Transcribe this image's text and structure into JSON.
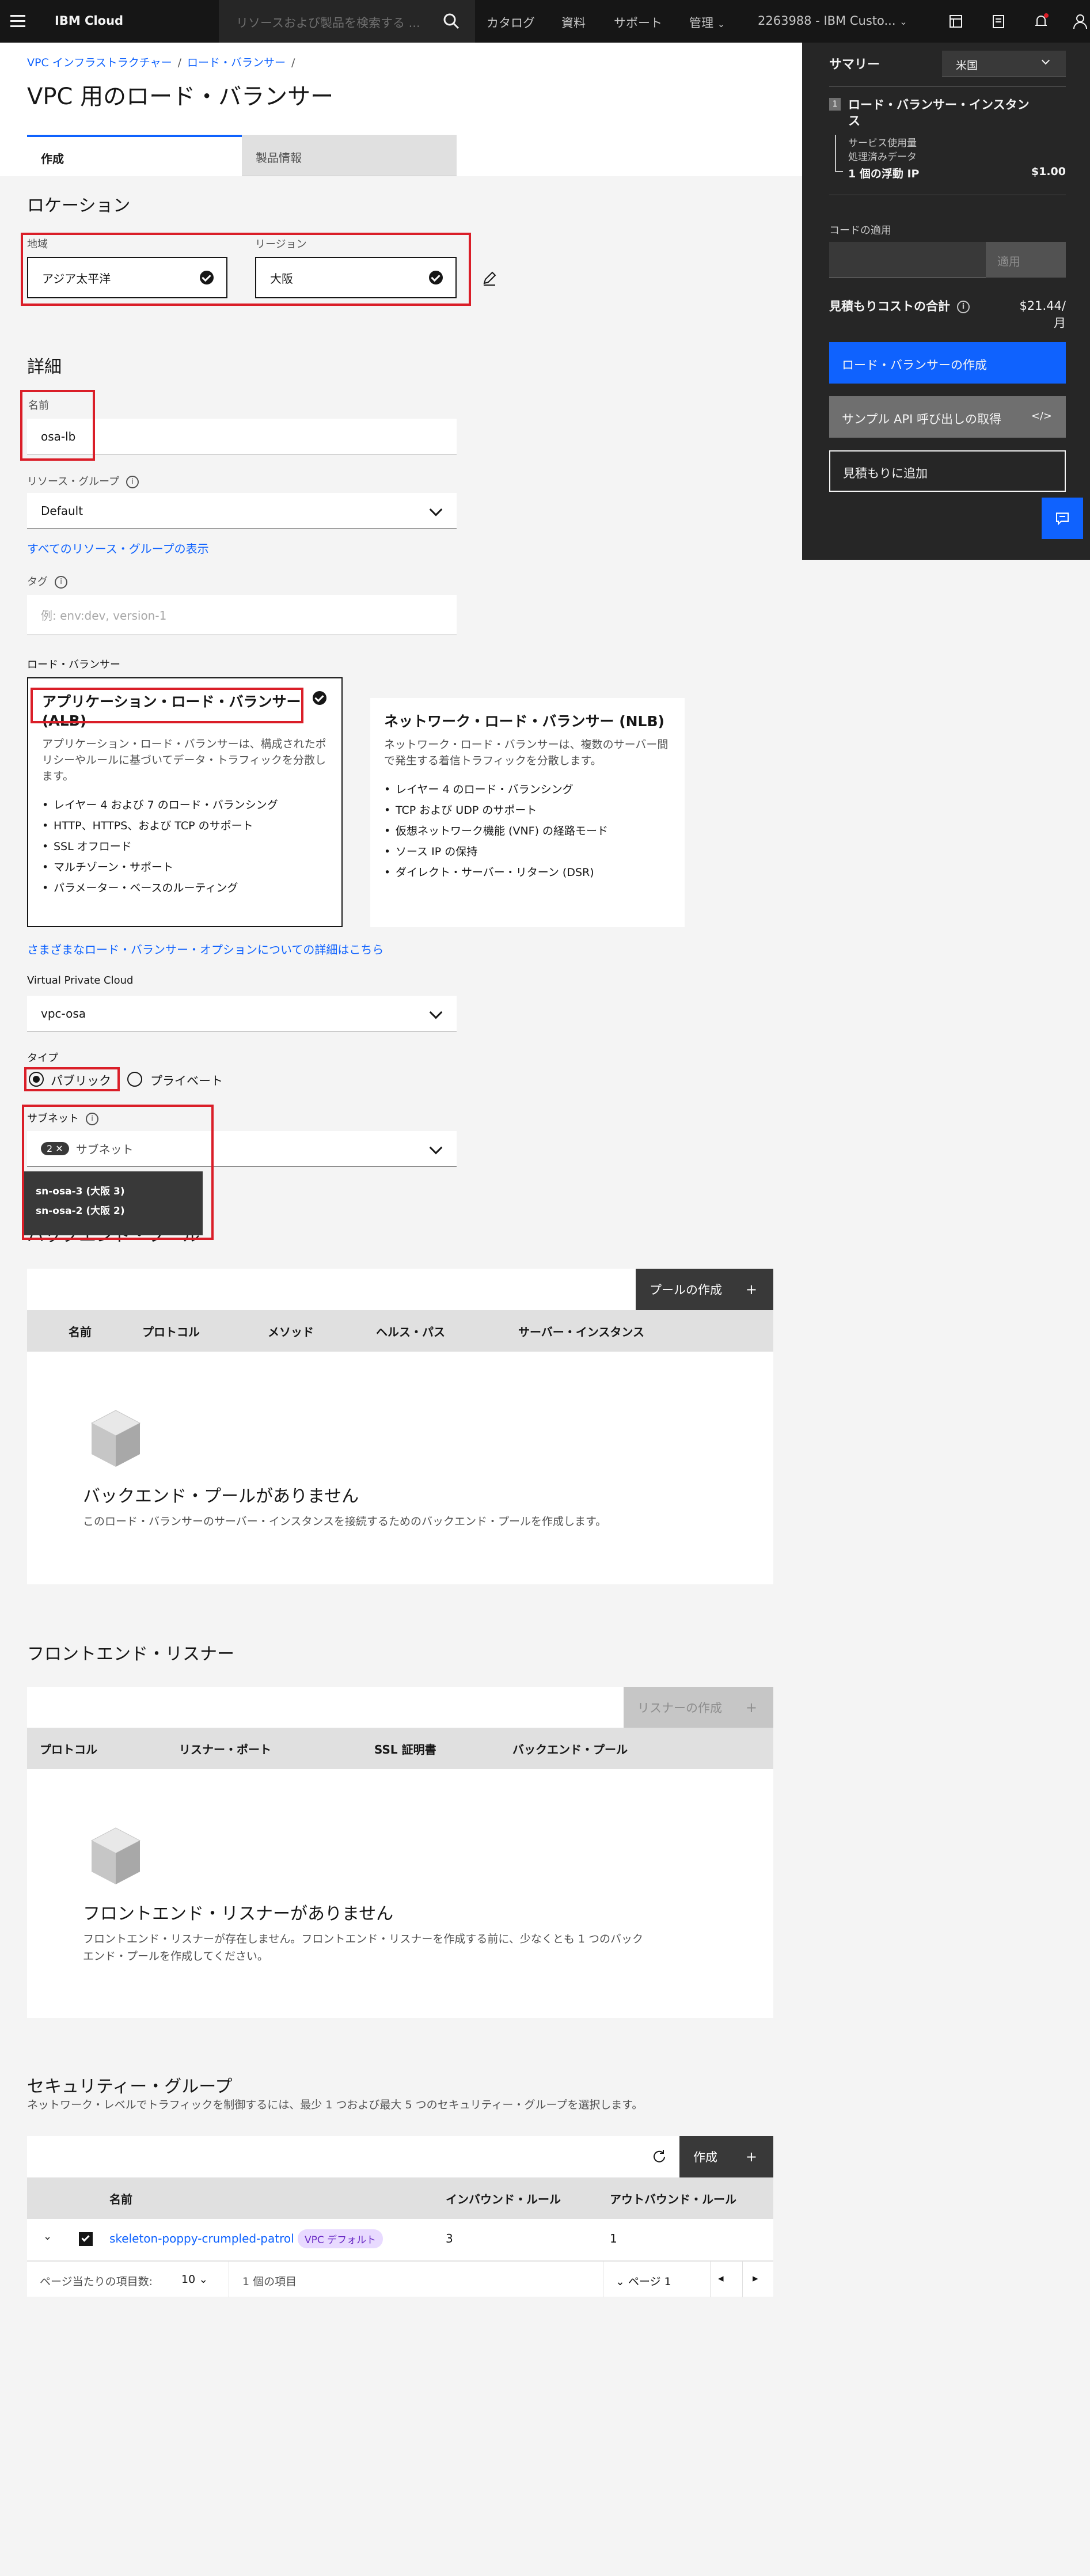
{
  "header": {
    "brand": "IBM Cloud",
    "search_placeholder": "リソースおよび製品を検索する ...",
    "nav": [
      "カタログ",
      "資料",
      "サポート",
      "管理"
    ],
    "account": "2263988 - IBM Custo..."
  },
  "breadcrumb": [
    "VPC インフラストラクチャー",
    "ロード・バランサー",
    ""
  ],
  "page_title": "VPC 用のロード・バランサー",
  "tabs": [
    "作成",
    "製品情報"
  ],
  "location": {
    "heading": "ロケーション",
    "geo_label": "地域",
    "geo_value": "アジア太平洋",
    "region_label": "リージョン",
    "region_value": "大阪"
  },
  "details": {
    "heading": "詳細",
    "name_label": "名前",
    "name_value": "osa-lb",
    "resource_group_label": "リソース・グループ",
    "resource_group_value": "Default",
    "resource_group_link": "すべてのリソース・グループの表示",
    "tags_label": "タグ",
    "tags_placeholder": "例: env:dev, version-1"
  },
  "load_balancer": {
    "label": "ロード・バランサー",
    "alb": {
      "title": "アプリケーション・ロード・バランサー (ALB)",
      "desc": "アプリケーション・ロード・バランサーは、構成されたポリシーやルールに基づいてデータ・トラフィックを分散します。",
      "features": [
        "レイヤー 4 および 7 のロード・バランシング",
        "HTTP、HTTPS、および TCP のサポート",
        "SSL オフロード",
        "マルチゾーン・サポート",
        "パラメーター・ベースのルーティング"
      ]
    },
    "nlb": {
      "title": "ネットワーク・ロード・バランサー (NLB)",
      "desc": "ネットワーク・ロード・バランサーは、複数のサーバー間で発生する着信トラフィックを分散します。",
      "features": [
        "レイヤー 4 のロード・バランシング",
        "TCP および UDP のサポート",
        "仮想ネットワーク機能 (VNF) の経路モード",
        "ソース IP の保持",
        "ダイレクト・サーバー・リターン (DSR)"
      ]
    },
    "more_link": "さまざまなロード・バランサー・オプションについての詳細はこちら"
  },
  "vpc": {
    "label": "Virtual Private Cloud",
    "value": "vpc-osa"
  },
  "type": {
    "label": "タイプ",
    "public": "パブリック",
    "private": "プライベート"
  },
  "subnet": {
    "label": "サブネット",
    "count": "2",
    "placeholder": "サブネット",
    "options": [
      "sn-osa-3 (大阪 3)",
      "sn-osa-2 (大阪 2)"
    ]
  },
  "pools": {
    "heading_partial": "バックエンド・プール",
    "create_btn": "プールの作成",
    "columns": [
      "名前",
      "プロトコル",
      "メソッド",
      "ヘルス・パス",
      "サーバー・インスタンス"
    ],
    "empty_title": "バックエンド・プールがありません",
    "empty_desc": "このロード・バランサーのサーバー・インスタンスを接続するためのバックエンド・プールを作成します。"
  },
  "listeners": {
    "heading": "フロントエンド・リスナー",
    "create_btn": "リスナーの作成",
    "columns": [
      "プロトコル",
      "リスナー・ポート",
      "SSL 証明書",
      "バックエンド・プール"
    ],
    "empty_title": "フロントエンド・リスナーがありません",
    "empty_desc1": "フロントエンド・リスナーが存在しません。フロントエンド・リスナーを作成する前に、少なくとも 1 つのバック",
    "empty_desc2": "エンド・プールを作成してください。"
  },
  "security": {
    "heading": "セキュリティー・グループ",
    "desc": "ネットワーク・レベルでトラフィックを制御するには、最少 1 つおよび最大 5 つのセキュリティー・グループを選択します。",
    "create_btn": "作成",
    "columns": [
      "名前",
      "インバウンド・ルール",
      "アウトバウンド・ルール"
    ],
    "row": {
      "name": "skeleton-poppy-crumpled-patrol",
      "tag": "VPC デフォルト",
      "inbound": "3",
      "outbound": "1"
    },
    "pagination": {
      "per_page_label": "ページ当たりの項目数:",
      "per_page": "10",
      "items": "1 個の項目",
      "page": "ページ 1"
    }
  },
  "summary": {
    "title": "サマリー",
    "region": "米国",
    "item_num": "1",
    "item_title": "ロード・バランサー・インスタンス",
    "sub1": "サービス使用量",
    "sub2": "処理済みデータ",
    "floating_ip": "1 個の浮動 IP",
    "floating_price": "$1.00",
    "code_label": "コードの適用",
    "apply_btn": "適用",
    "total_label": "見積もりコストの合計",
    "total_price": "$21.44/",
    "total_unit": "月",
    "create_btn": "ロード・バランサーの作成",
    "api_btn": "サンプル API 呼び出しの取得",
    "add_btn": "見積もりに追加"
  }
}
